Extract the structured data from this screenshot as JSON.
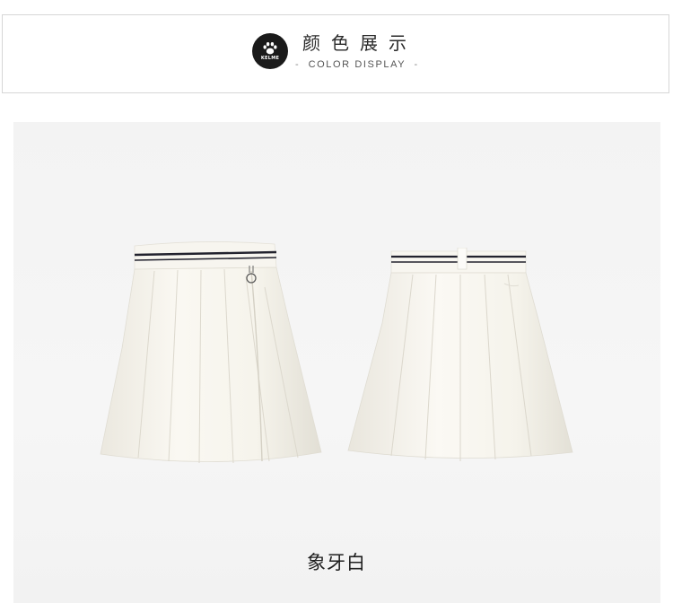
{
  "header": {
    "title_cn": "颜色展示",
    "subtitle_en": "COLOR DISPLAY",
    "logo_text": "KELME",
    "logo_icon": "paw-icon"
  },
  "product": {
    "color_name": "象牙白",
    "views": [
      "front-view",
      "back-view"
    ]
  },
  "colors": {
    "logo_bg": "#1a1a1a",
    "panel_bg": "#f4f4f4",
    "skirt": "#f7f5ee",
    "stripe": "#1e1e2a"
  }
}
